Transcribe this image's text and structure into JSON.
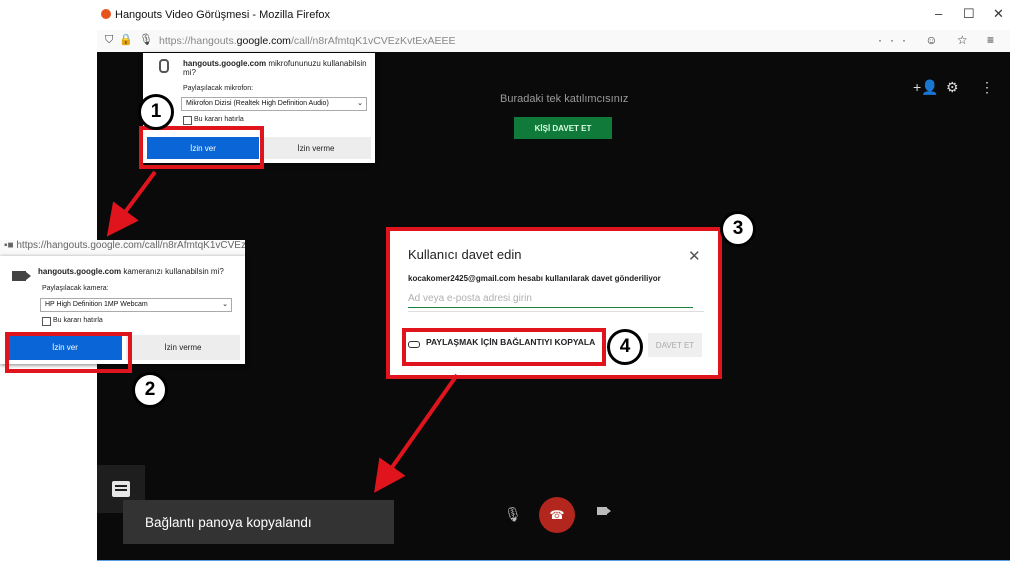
{
  "window": {
    "title": "Hangouts Video Görüşmesi - Mozilla Firefox",
    "url_prefix": "https://hangouts.",
    "url_domain": "google.com",
    "url_path": "/call/n8rAfmtqK1vCVEzKvtExAEEE",
    "controls": {
      "minimize": "–",
      "maximize": "☐",
      "close": "✕"
    },
    "url_icons_right": "··· ☺ ☆ ≡"
  },
  "mic_prompt": {
    "domain": "hangouts.google.com",
    "question": " mikrofununuzu kullanabilsin mi?",
    "share_label": "Paylaşılacak mikrofon:",
    "selected_device": "Mikrofon Dizisi (Realtek High Definition Audio)",
    "remember": "Bu kararı hatırla",
    "allow": "İzin ver",
    "deny": "İzin verme"
  },
  "cam_prompt": {
    "url": "https://hangouts.google.com/call/n8rAfmtqK1vCVEzKv",
    "domain": "hangouts.google.com",
    "question": " kameranızı kullanabilsin mi?",
    "share_label": "Paylaşılacak kamera:",
    "selected_device": "HP High Definition 1MP Webcam",
    "remember": "Bu kararı hatırla",
    "allow": "İzin ver",
    "deny": "İzin verme"
  },
  "call": {
    "alone_text": "Buradaki tek katılımcısınız",
    "invite_button": "KİŞİ DAVET ET",
    "toast": "Bağlantı panoya kopyalandı"
  },
  "invite_dialog": {
    "title": "Kullanıcı davet edin",
    "subtitle": "kocakomer2425@gmail.com hesabı kullanılarak davet gönderiliyor",
    "placeholder": "Ad veya e-posta adresi girin",
    "copy_link": "PAYLAŞMAK İÇİN BAĞLANTIYI KOPYALA",
    "invite": "DAVET ET",
    "close": "✕"
  },
  "badges": [
    "1",
    "2",
    "3",
    "4"
  ],
  "colors": {
    "callout_red": "#e0141c",
    "allow_blue": "#0a66d6",
    "hangouts_green": "#0f7a3a",
    "end_call_red": "#b3261e"
  }
}
